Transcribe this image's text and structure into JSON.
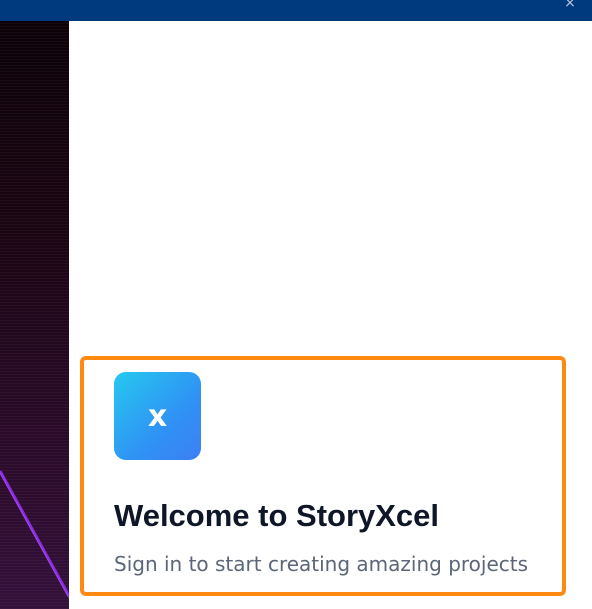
{
  "window": {
    "close_icon": "close-icon",
    "close_glyph": "×",
    "titlebar_color": "#003a7e"
  },
  "side_panel": {
    "accent_color": "#8a2be2"
  },
  "welcome": {
    "logo_letter": "x",
    "title": "Welcome to StoryXcel",
    "subtitle": "Sign in to start creating amazing projects",
    "highlight_color": "#ff8a12",
    "logo_gradient": [
      "#26c8ef",
      "#3d7ef5"
    ]
  }
}
